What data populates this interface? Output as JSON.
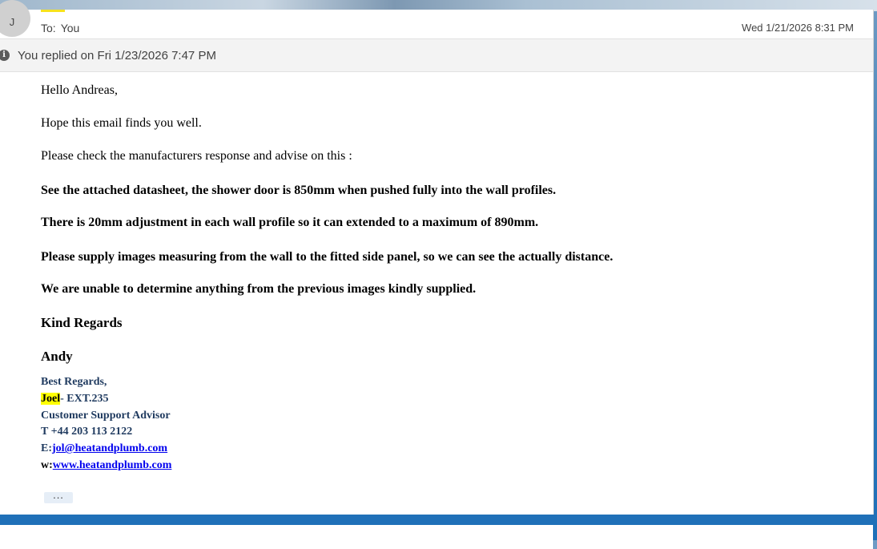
{
  "header": {
    "avatar_initial": "J",
    "to_label": "To:",
    "to_value": "You",
    "date": "Wed 1/21/2026 8:31 PM"
  },
  "info_bar": {
    "text": "You replied on Fri 1/23/2026 7:47 PM"
  },
  "body": {
    "greeting": "Hello Andreas,",
    "line1": "Hope this email finds you well.",
    "line2": "Please check the manufacturers response and advise on this :",
    "bold1": "See the attached datasheet, the shower door is 850mm when pushed fully into the wall profiles.",
    "bold2": "There is 20mm adjustment in each wall profile so it can extended to a maximum of 890mm.",
    "bold3": "Please supply images measuring from the wall to the fitted side panel, so we can see the actually distance.",
    "bold4": "We are unable to determine anything from the previous images kindly supplied.",
    "closing": "Kind Regards",
    "name": "Andy"
  },
  "signature": {
    "regards": "Best Regards,",
    "name_highlight": "Joel",
    "ext": "- EXT.235",
    "role": "Customer Support Advisor",
    "phone": "T +44 203 113 2122",
    "email_prefix": "E:",
    "email": "jol@heatandplumb.com",
    "web_prefix": "w:",
    "web": "www.heatandplumb.com"
  },
  "more_button": "..."
}
